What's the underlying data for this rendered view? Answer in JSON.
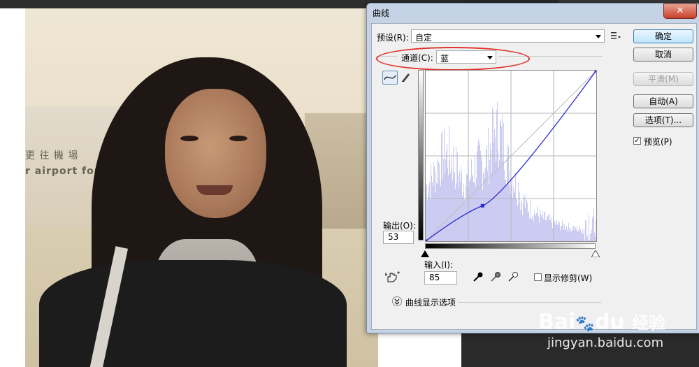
{
  "dialog": {
    "title": "曲线",
    "close_glyph": "✕",
    "preset_label": "预设(R):",
    "preset_value": "自定",
    "channel_label": "通道(C):",
    "channel_value": "蓝",
    "output_label": "输出(O):",
    "output_value": "53",
    "input_label": "输入(I):",
    "input_value": "85",
    "show_clipping_label": "显示修剪(W)",
    "curve_display_options_label": "曲线显示选项",
    "buttons": {
      "ok": "确定",
      "cancel": "取消",
      "smooth": "平滑(M)",
      "auto": "自动(A)",
      "options": "选项(T)..."
    },
    "preview_label": "预览(P)",
    "preview_checked": true,
    "show_clipping_checked": false
  },
  "background": {
    "sign_line1": "更 往 機 場",
    "sign_line2": "r airport for s"
  },
  "watermark": {
    "brand": "Bai",
    "brand2": "du",
    "brand_cn": "经验",
    "url": "jingyan.baidu.com"
  },
  "curve": {
    "channel_color": "#2b2bd6",
    "histogram_color": "#ccccf2",
    "input_range": [
      0,
      255
    ],
    "output_range": [
      0,
      255
    ],
    "control_points": [
      [
        0,
        0
      ],
      [
        85,
        53
      ],
      [
        255,
        255
      ]
    ]
  }
}
